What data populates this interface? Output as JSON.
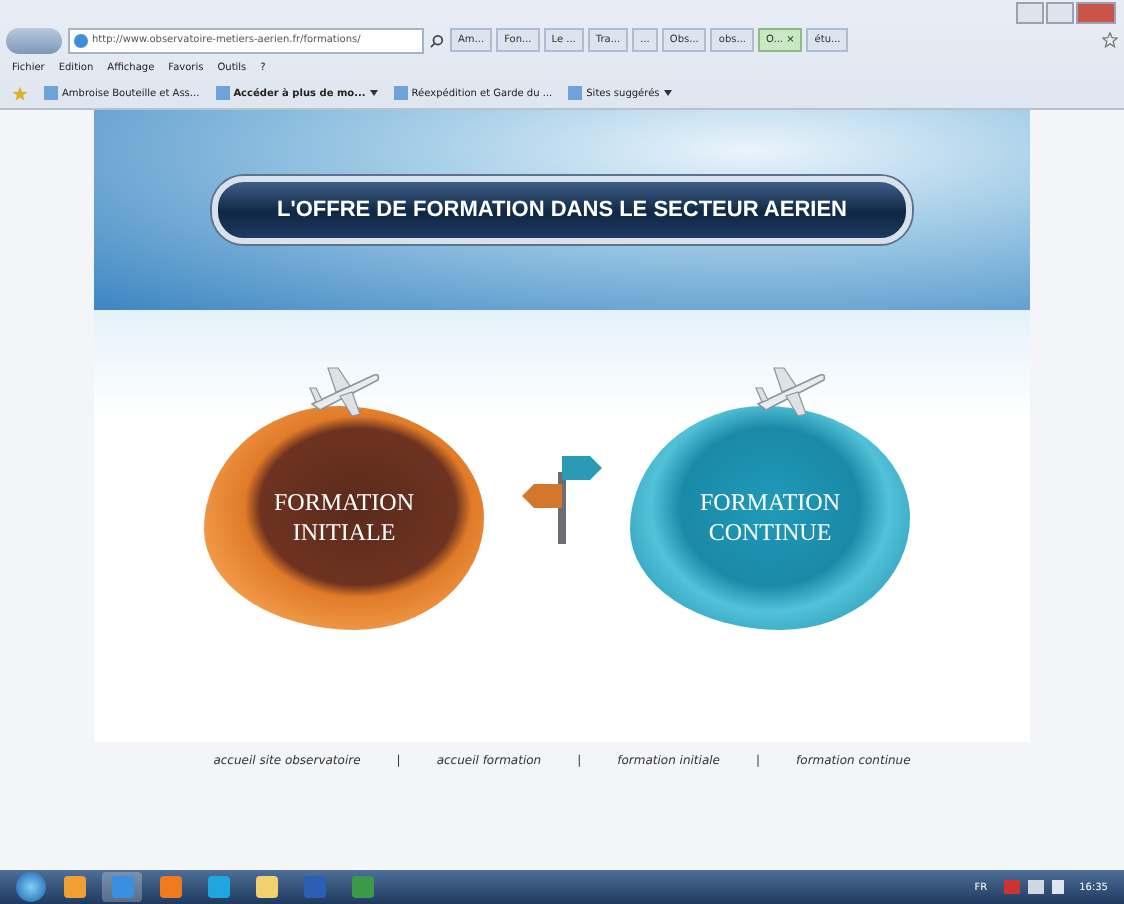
{
  "browser": {
    "address": "http://www.observatoire-metiers-aerien.fr/formations/",
    "tabs": [
      {
        "label": "Am...",
        "selected": false
      },
      {
        "label": "Fon...",
        "selected": false
      },
      {
        "label": "Le ...",
        "selected": false
      },
      {
        "label": "Tra...",
        "selected": false
      },
      {
        "label": "...",
        "selected": false
      },
      {
        "label": "Obs...",
        "selected": false
      },
      {
        "label": "obs...",
        "selected": false
      },
      {
        "label": "O... ×",
        "selected": true
      },
      {
        "label": "étu...",
        "selected": false
      }
    ],
    "menu": [
      "Fichier",
      "Edition",
      "Affichage",
      "Favoris",
      "Outils",
      "?"
    ],
    "favorites": [
      {
        "label": "Ambroise Bouteille et Ass...",
        "bold": false,
        "dropdown": false
      },
      {
        "label": "Accéder à plus de mo...",
        "bold": true,
        "dropdown": true
      },
      {
        "label": "Réexpédition et Garde du ...",
        "bold": false,
        "dropdown": false
      },
      {
        "label": "Sites suggérés",
        "bold": false,
        "dropdown": true
      }
    ]
  },
  "page": {
    "banner_title": "L'OFFRE DE FORMATION DANS LE SECTEUR AERIEN",
    "choices": [
      {
        "kind": "initial",
        "label": "FORMATION INITIALE"
      },
      {
        "kind": "continuing",
        "label": "FORMATION CONTINUE"
      }
    ],
    "footer_links": [
      "accueil site observatoire",
      "accueil formation",
      "formation initiale",
      "formation continue"
    ],
    "separator": "|"
  },
  "taskbar": {
    "language": "FR",
    "time": "16:35"
  }
}
